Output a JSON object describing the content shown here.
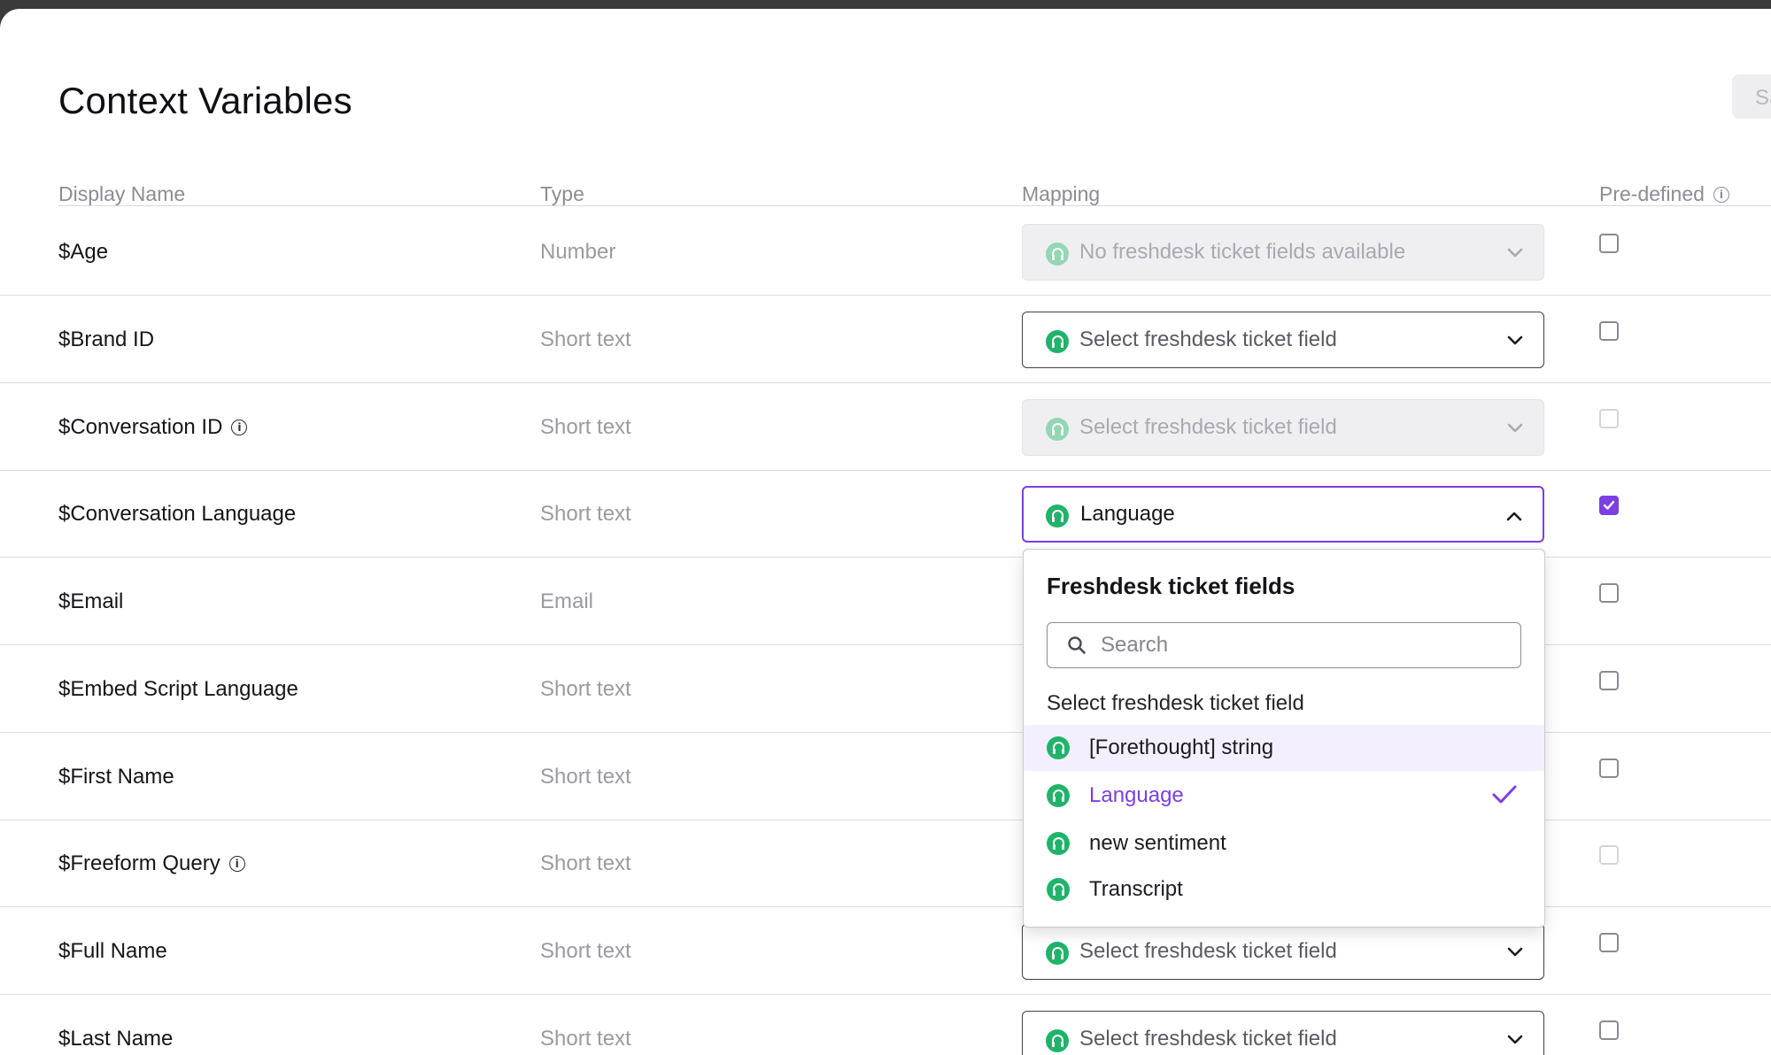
{
  "page": {
    "title": "Context Variables",
    "save_label": "Sa"
  },
  "columns": {
    "display_name": "Display Name",
    "type": "Type",
    "mapping": "Mapping",
    "predefined": "Pre-defined"
  },
  "rows": [
    {
      "name": "$Age",
      "type": "Number",
      "mapping": "No freshdesk ticket fields available",
      "mapping_state": "disabled",
      "has_info": false,
      "predefined": false,
      "predefined_disabled": false
    },
    {
      "name": "$Brand ID",
      "type": "Short text",
      "mapping": "Select freshdesk ticket field",
      "mapping_state": "enabled",
      "has_info": false,
      "predefined": false,
      "predefined_disabled": false
    },
    {
      "name": "$Conversation ID",
      "type": "Short text",
      "mapping": "Select freshdesk ticket field",
      "mapping_state": "disabled",
      "has_info": true,
      "predefined": false,
      "predefined_disabled": true
    },
    {
      "name": "$Conversation Language",
      "type": "Short text",
      "mapping": "Language",
      "mapping_state": "open",
      "has_info": false,
      "predefined": true,
      "predefined_disabled": false
    },
    {
      "name": "$Email",
      "type": "Email",
      "has_info": false,
      "predefined": false,
      "predefined_disabled": false
    },
    {
      "name": "$Embed Script Language",
      "type": "Short text",
      "has_info": false,
      "predefined": false,
      "predefined_disabled": false
    },
    {
      "name": "$First Name",
      "type": "Short text",
      "has_info": false,
      "predefined": false,
      "predefined_disabled": false
    },
    {
      "name": "$Freeform Query",
      "type": "Short text",
      "has_info": true,
      "predefined": false,
      "predefined_disabled": true
    },
    {
      "name": "$Full Name",
      "type": "Short text",
      "mapping": "Select freshdesk ticket field",
      "mapping_state": "enabled",
      "has_info": false,
      "predefined": false,
      "predefined_disabled": false
    },
    {
      "name": "$Last Name",
      "type": "Short text",
      "mapping": "Select freshdesk ticket field",
      "mapping_state": "enabled",
      "has_info": false,
      "predefined": false,
      "predefined_disabled": false
    }
  ],
  "dropdown": {
    "title": "Freshdesk ticket fields",
    "search_placeholder": "Search",
    "section_label": "Select freshdesk ticket field",
    "options": [
      {
        "label": "[Forethought] string",
        "hovered": true,
        "selected": false
      },
      {
        "label": "Language",
        "hovered": false,
        "selected": true
      },
      {
        "label": "new sentiment",
        "hovered": false,
        "selected": false
      },
      {
        "label": "Transcript",
        "hovered": false,
        "selected": false
      }
    ]
  },
  "colors": {
    "accent": "#7b3fe4",
    "freshdesk_green": "#20b36a",
    "hover_bg": "#f4efff"
  },
  "icons": {
    "freshdesk": "headset-icon",
    "info": "info-icon",
    "chevron_down": "chevron-down-icon",
    "chevron_up": "chevron-up-icon",
    "search": "search-icon",
    "check": "checkmark-icon"
  }
}
